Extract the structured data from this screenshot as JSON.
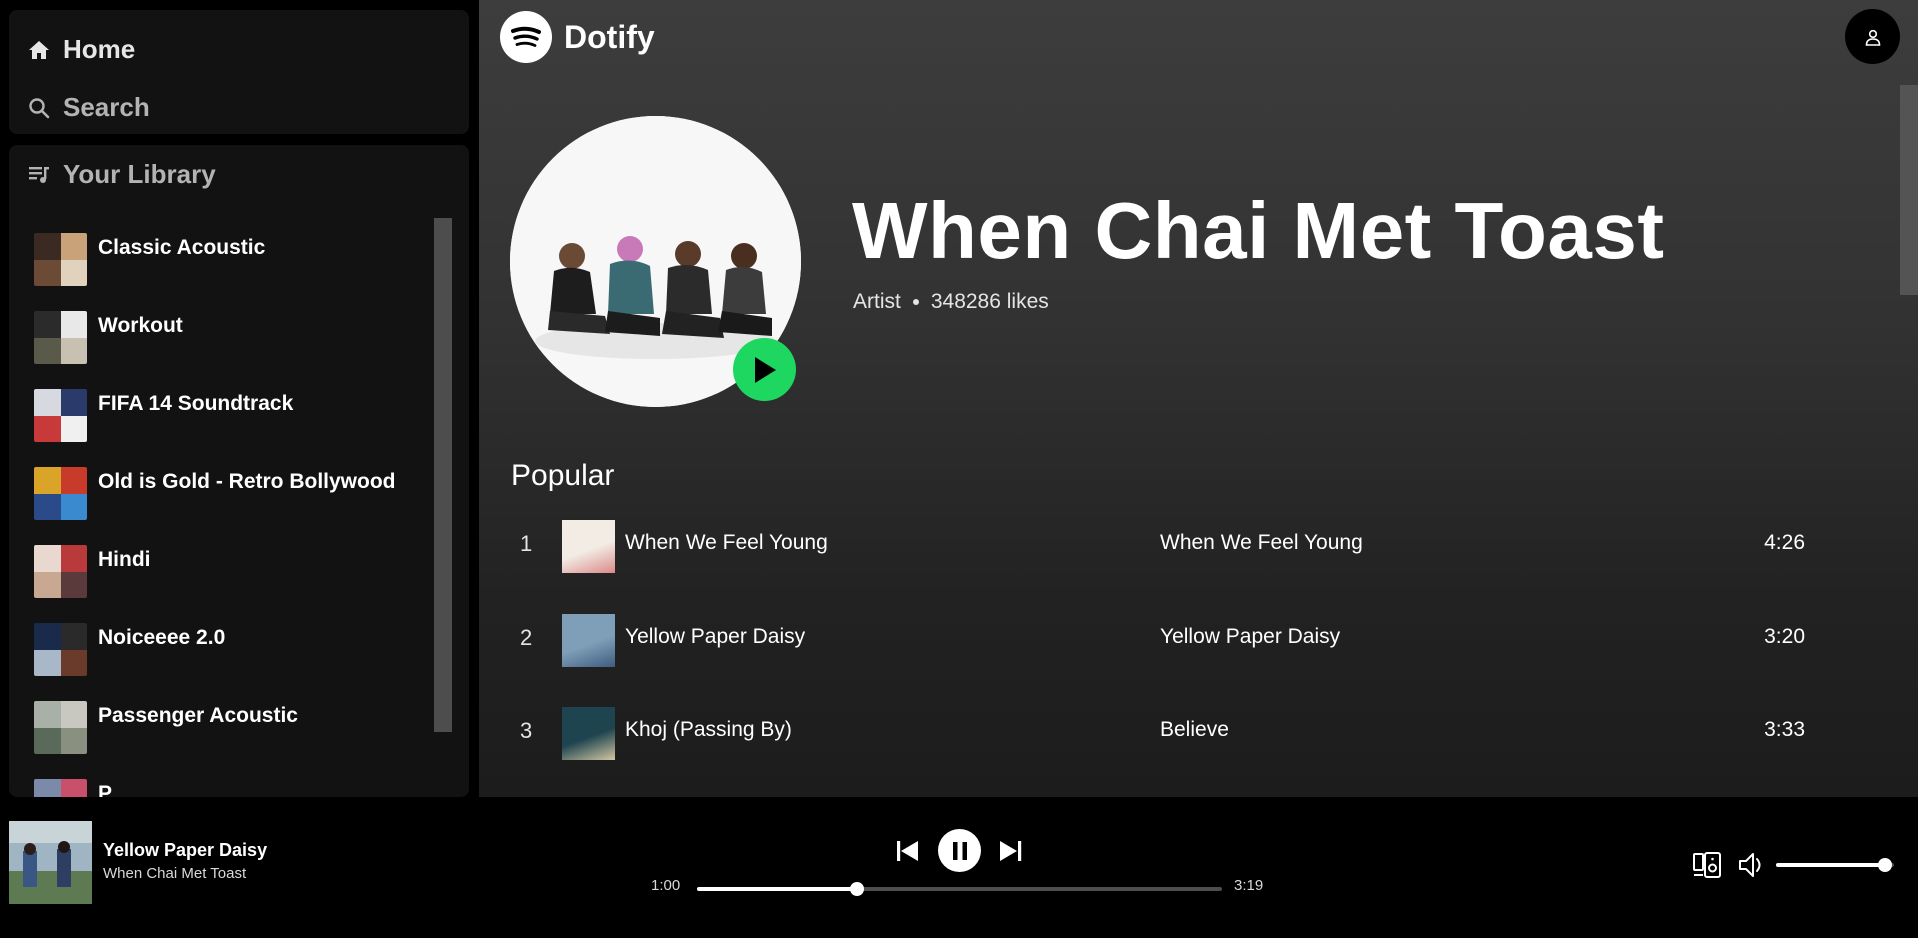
{
  "sidebar": {
    "home_label": "Home",
    "search_label": "Search",
    "library_label": "Your Library",
    "playlists": [
      {
        "name": "Classic Acoustic",
        "colors": [
          "#3a2a22",
          "#c9a27a",
          "#6b4b36",
          "#e0d2bd"
        ]
      },
      {
        "name": "Workout",
        "colors": [
          "#2b2b2b",
          "#e8e8e8",
          "#5a5a4a",
          "#c8c0b0"
        ]
      },
      {
        "name": "FIFA 14 Soundtrack",
        "colors": [
          "#d6d9e0",
          "#2a3b6b",
          "#c83a3a",
          "#f0f0f0"
        ]
      },
      {
        "name": "Old is Gold - Retro Bollywood",
        "colors": [
          "#d9a428",
          "#c83a2a",
          "#2a4a8a",
          "#3a8ad0"
        ]
      },
      {
        "name": "Hindi",
        "colors": [
          "#e8d8d0",
          "#b83a3a",
          "#c8a890",
          "#5a3a3a"
        ]
      },
      {
        "name": "Noiceeee 2.0",
        "colors": [
          "#1a2a4a",
          "#2a2a2a",
          "#a8b8c8",
          "#6a3a2a"
        ]
      },
      {
        "name": "Passenger Acoustic",
        "colors": [
          "#a8b0a8",
          "#c8c8c0",
          "#5a6a5a",
          "#8a9080"
        ]
      },
      {
        "name": "P",
        "colors": [
          "#7a8aa8",
          "#c8506a",
          "#a8a8a8",
          "#5a5a5a"
        ]
      }
    ]
  },
  "header": {
    "brand_name": "Dotify"
  },
  "artist": {
    "name": "When Chai Met Toast",
    "type_label": "Artist",
    "likes_text": "348286 likes"
  },
  "popular": {
    "heading": "Popular",
    "tracks": [
      {
        "num": "1",
        "title": "When We Feel Young",
        "album": "When We Feel Young",
        "duration": "4:26",
        "colors": [
          "#f3ece4",
          "#d98a8a"
        ]
      },
      {
        "num": "2",
        "title": "Yellow Paper Daisy",
        "album": "Yellow Paper Daisy",
        "duration": "3:20",
        "colors": [
          "#7f9fb8",
          "#3e5d80"
        ]
      },
      {
        "num": "3",
        "title": "Khoj (Passing By)",
        "album": "Believe",
        "duration": "3:33",
        "colors": [
          "#1e4450",
          "#d2c7a2"
        ]
      }
    ]
  },
  "player": {
    "title": "Yellow Paper Daisy",
    "artist": "When Chai Met Toast",
    "current_time": "1:00",
    "total_time": "3:19",
    "progress": 0.305,
    "volume": 0.92
  },
  "icons": {
    "home": "home-icon",
    "search": "search-icon",
    "library": "library-icon",
    "brand": "dotify-logo-icon",
    "profile": "user-icon",
    "play": "play-icon",
    "prev": "skip-previous-icon",
    "pause": "pause-icon",
    "next": "skip-next-icon",
    "device": "connect-device-icon",
    "volume": "volume-icon"
  },
  "colors": {
    "accent": "#1ed760",
    "panel": "#121212"
  }
}
